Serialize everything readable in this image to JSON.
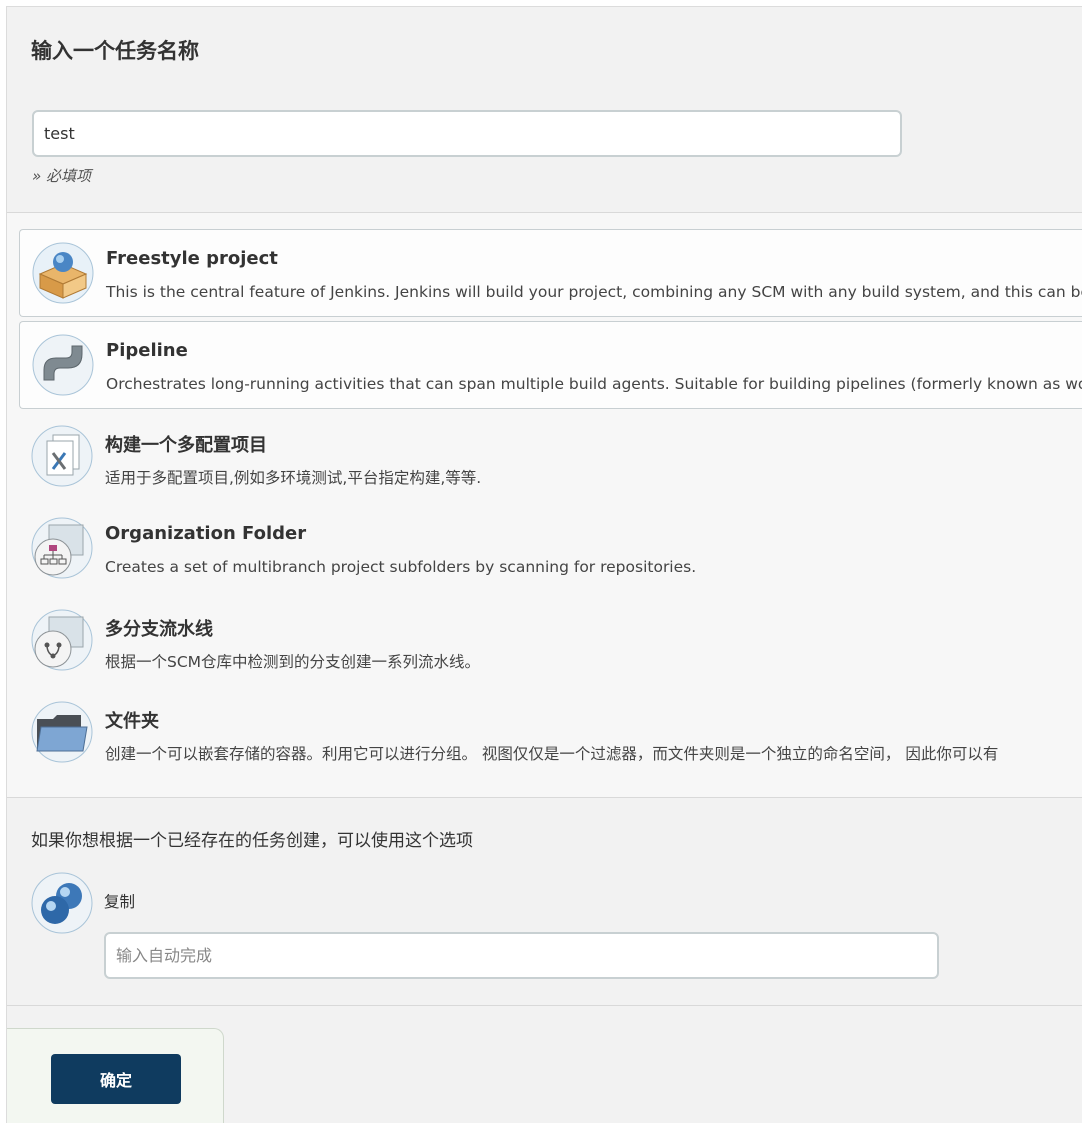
{
  "name_section": {
    "title": "输入一个任务名称",
    "input_value": "test",
    "required_hint": "» 必填项"
  },
  "item_types": [
    {
      "label": "Freestyle project",
      "desc": "This is the central feature of Jenkins. Jenkins will build your project, combining any SCM with any build system, and this can be even",
      "icon": "freestyle-package-icon"
    },
    {
      "label": "Pipeline",
      "desc": "Orchestrates long-running activities that can span multiple build agents. Suitable for building pipelines (formerly known as workflows",
      "icon": "pipeline-pipe-icon"
    },
    {
      "label": "构建一个多配置项目",
      "desc": "适用于多配置项目,例如多环境测试,平台指定构建,等等.",
      "icon": "multi-config-icon"
    },
    {
      "label": "Organization Folder",
      "desc": "Creates a set of multibranch project subfolders by scanning for repositories.",
      "icon": "organization-folder-icon"
    },
    {
      "label": "多分支流水线",
      "desc": "根据一个SCM仓库中检测到的分支创建一系列流水线。",
      "icon": "multibranch-pipeline-icon"
    },
    {
      "label": "文件夹",
      "desc": "创建一个可以嵌套存储的容器。利用它可以进行分组。 视图仅仅是一个过滤器，而文件夹则是一个独立的命名空间， 因此你可以有",
      "icon": "folder-icon"
    }
  ],
  "copy_section": {
    "prompt": "如果你想根据一个已经存在的任务创建，可以使用这个选项",
    "label": "复制",
    "placeholder": "输入自动完成",
    "icon": "copy-spheres-icon"
  },
  "footer": {
    "ok_label": "确定"
  },
  "colors": {
    "button_bg": "#0f3b5f",
    "page_bg": "#f2f2f2",
    "input_border": "#c8d0d2"
  }
}
